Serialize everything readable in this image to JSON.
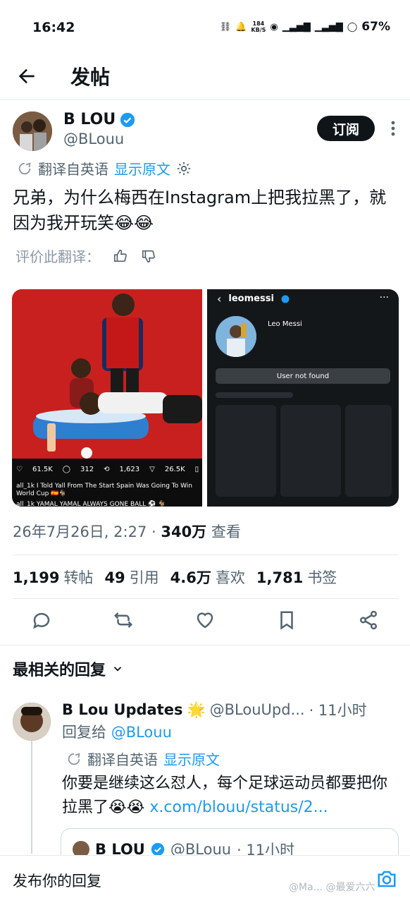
{
  "status": {
    "time": "16:42",
    "net_speed_value": "184",
    "net_speed_unit": "KB/S",
    "battery": "67%"
  },
  "header": {
    "title": "发帖"
  },
  "post": {
    "author_name": "B LOU",
    "author_handle": "@BLouu",
    "subscribe_label": "订阅",
    "translated_from": "翻译自英语",
    "show_original": "显示原文",
    "text": "兄弟，为什么梅西在Instagram上把我拉黑了，就因为我开玩笑😂😂",
    "rate_translation": "评价此翻译：",
    "timestamp": "26年7月26日, 2:27 · ",
    "views_count": "340万",
    "views_label": " 查看",
    "stats": [
      {
        "count": "1,199",
        "label": "转帖"
      },
      {
        "count": "49",
        "label": "引用"
      },
      {
        "count": "4.6万",
        "label": "喜欢"
      },
      {
        "count": "1,781",
        "label": "书签"
      }
    ]
  },
  "media_left": {
    "likes": "61.5K",
    "comments": "312",
    "reposts": "1,623",
    "shares": "26.5K",
    "caption_line1": "all_1k I Told Yall From The Start Spain Was Going To Win",
    "caption_line2": "World Cup 🇪🇸🐐",
    "caption_line3": "all_1k YAMAL YAMAL ALWAYS GONE BALL ⚽ 🐐"
  },
  "media_right": {
    "username": "leomessi",
    "display_name": "Leo Messi",
    "not_found": "User not found"
  },
  "replies": {
    "sort_label": "最相关的回复",
    "items": [
      {
        "name": "B Lou Updates",
        "badge": "🌟",
        "handle": "@BLouUpd...",
        "time": "· 11小时",
        "reply_to_prefix": "回复给 ",
        "reply_to_handle": "@BLouu",
        "translated_from": "翻译自英语",
        "show_original": "显示原文",
        "text": "你要是继续这么怼人，每个足球运动员都要把你拉黑了😭😭 ",
        "link": "x.com/blouu/status/2..."
      }
    ],
    "quote": {
      "name": "B LOU",
      "handle": "@BLouu",
      "time": "· 11小时"
    }
  },
  "bottom_bar": {
    "placeholder": "发布你的回复",
    "watermark": "@Ma... @最爱六六"
  },
  "colors": {
    "accent": "#1d9bf0",
    "text": "#0f1419",
    "muted": "#536471"
  }
}
